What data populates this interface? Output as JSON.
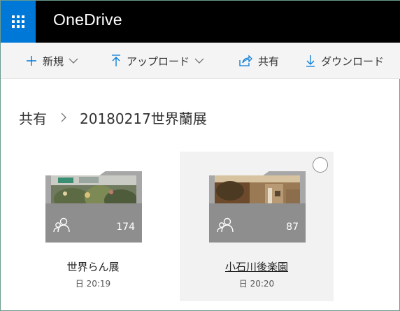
{
  "app": {
    "title": "OneDrive"
  },
  "commands": [
    {
      "label": "新規",
      "icon": "plus-icon",
      "dropdown": true
    },
    {
      "label": "アップロード",
      "icon": "upload-icon",
      "dropdown": true
    },
    {
      "label": "共有",
      "icon": "share-icon",
      "dropdown": false
    },
    {
      "label": "ダウンロード",
      "icon": "download-icon",
      "dropdown": false
    }
  ],
  "breadcrumb": {
    "root": "共有",
    "current": "20180217世界蘭展"
  },
  "folders": [
    {
      "name": "世界らん展",
      "count": "174",
      "date": "日 20:19",
      "selected": false,
      "shared": true
    },
    {
      "name": "小石川後楽園",
      "count": "87",
      "date": "日 20:20",
      "selected": true,
      "shared": true
    }
  ],
  "colors": {
    "accent": "#0078d7",
    "appbar": "#000000",
    "commandbar": "#f4f4f4",
    "folder": "#a7a7a7"
  }
}
